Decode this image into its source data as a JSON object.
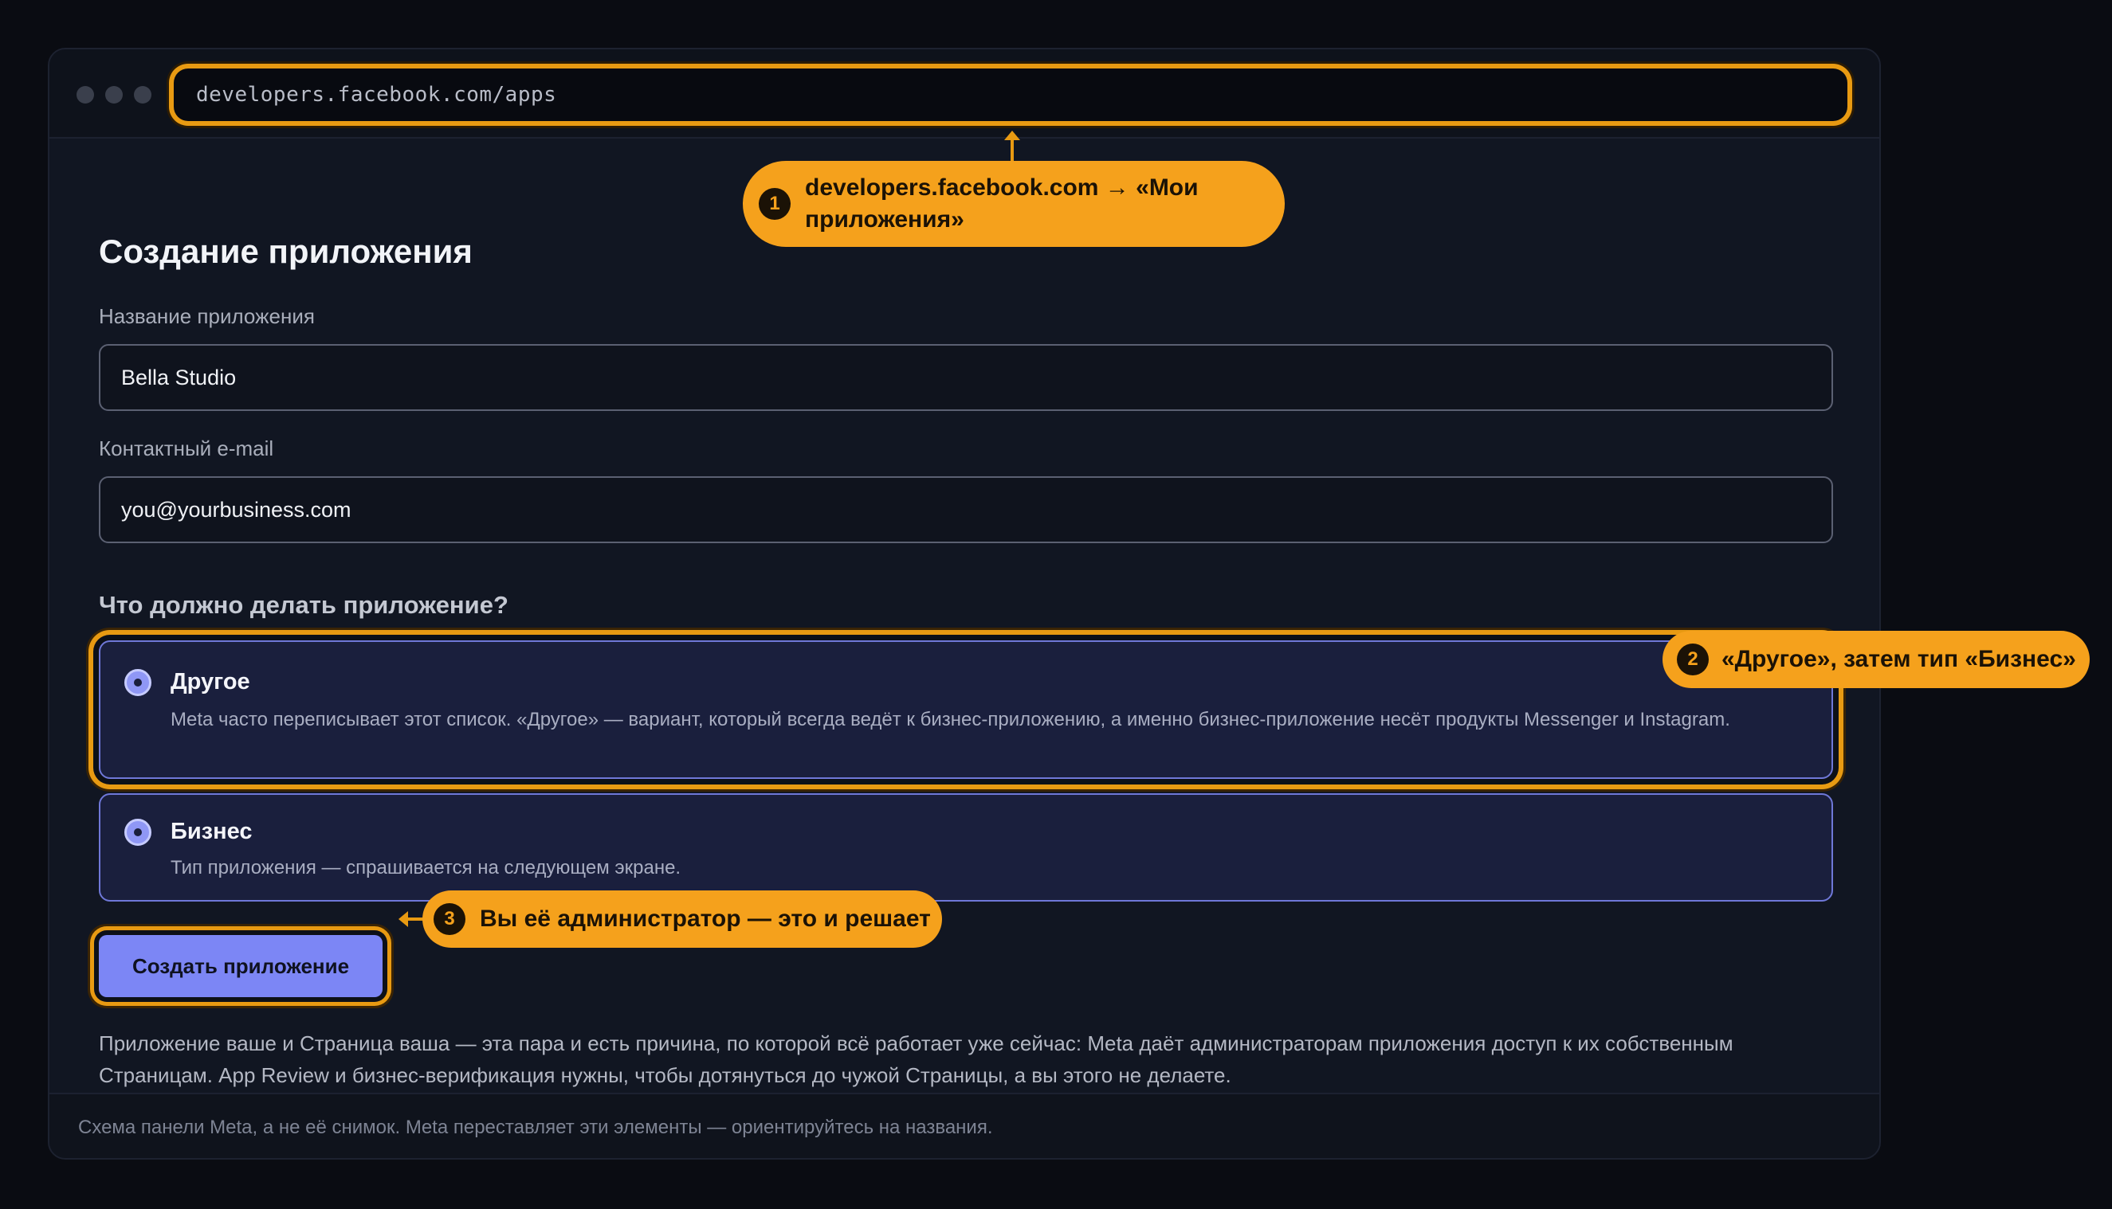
{
  "browser": {
    "url": "developers.facebook.com/apps"
  },
  "form": {
    "title": "Создание приложения",
    "name_label": "Название приложения",
    "name_value": "Bella Studio",
    "email_label": "Контактный e-mail",
    "email_value": "you@yourbusiness.com",
    "question": "Что должно делать приложение?",
    "options": [
      {
        "title": "Другое",
        "description": "Meta часто переписывает этот список. «Другое» — вариант, который всегда ведёт к бизнес-приложению, а именно бизнес-приложение несёт продукты Messenger и Instagram.",
        "selected": true
      },
      {
        "title": "Бизнес",
        "description": "Тип приложения — спрашивается на следующем экране.",
        "selected": true
      }
    ],
    "submit_label": "Создать приложение",
    "note": "Приложение ваше и Страница ваша — эта пара и есть причина, по которой всё работает уже сейчас: Meta даёт администраторам приложения доступ к их собственным Страницам. App Review и бизнес-верификация нужны, чтобы дотянуться до чужой Страницы, а вы этого не делаете."
  },
  "footer": {
    "text": "Схема панели Meta, а не её снимок. Meta переставляет эти элементы — ориентируйтесь на названия."
  },
  "callouts": [
    {
      "number": "1",
      "text": "developers.facebook.com → «Мои приложения»"
    },
    {
      "number": "2",
      "text": "«Другое», затем тип «Бизнес»"
    },
    {
      "number": "3",
      "text": "Вы её администратор — это и решает"
    }
  ],
  "colors": {
    "accent": "#7c86f5",
    "highlight": "#e89a12",
    "callout": "#f5a11c",
    "background": "#0a0c12"
  }
}
